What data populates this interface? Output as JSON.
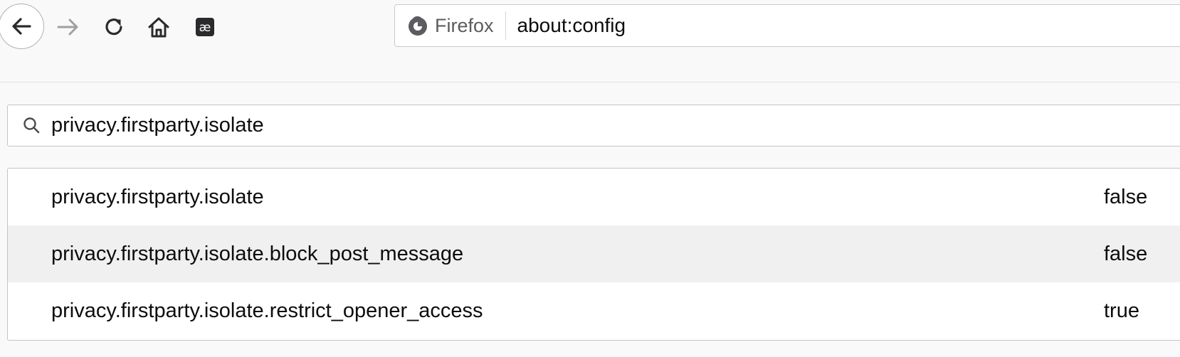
{
  "toolbar": {
    "back_icon": "arrow-left-icon",
    "forward_icon": "arrow-right-icon",
    "reload_icon": "reload-icon",
    "home_icon": "home-icon",
    "extension_icon": "ae-ligature-icon",
    "extension_glyph": "æ"
  },
  "urlbar": {
    "identity_label": "Firefox",
    "identity_icon": "firefox-logo-icon",
    "url": "about:config"
  },
  "search": {
    "icon": "search-icon",
    "value": "privacy.firstparty.isolate"
  },
  "prefs": [
    {
      "name": "privacy.firstparty.isolate",
      "value": "false"
    },
    {
      "name": "privacy.firstparty.isolate.block_post_message",
      "value": "false"
    },
    {
      "name": "privacy.firstparty.isolate.restrict_opener_access",
      "value": "true"
    }
  ],
  "colors": {
    "toolbar_bg": "#f9f9fa",
    "alt_row_bg": "#f0f0f1",
    "text": "#0c0c0d",
    "icon": "#3b3b3d",
    "disabled_icon": "#a0a0a3"
  }
}
